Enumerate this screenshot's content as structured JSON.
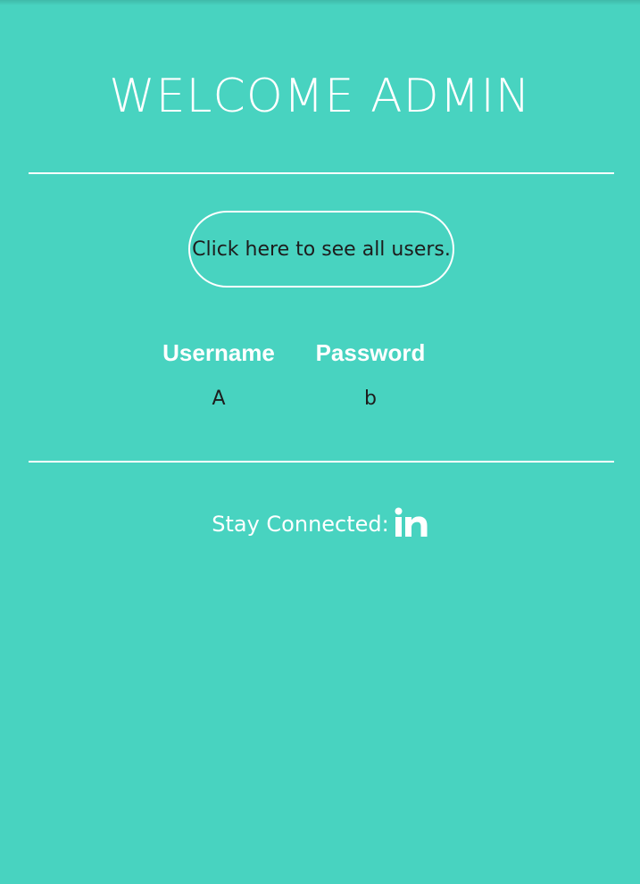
{
  "header": {
    "title": "WELCOME ADMIN"
  },
  "actions": {
    "view_users_label": "Click here to see all users."
  },
  "credentials_table": {
    "columns": [
      "Username",
      "Password"
    ],
    "rows": [
      [
        "A",
        "b"
      ]
    ]
  },
  "footer": {
    "label": "Stay Connected:",
    "social_icon": "linkedin-icon"
  },
  "colors": {
    "background": "#48d3c0",
    "text_light": "#ffffff",
    "text_dark": "#1d1d1d"
  }
}
